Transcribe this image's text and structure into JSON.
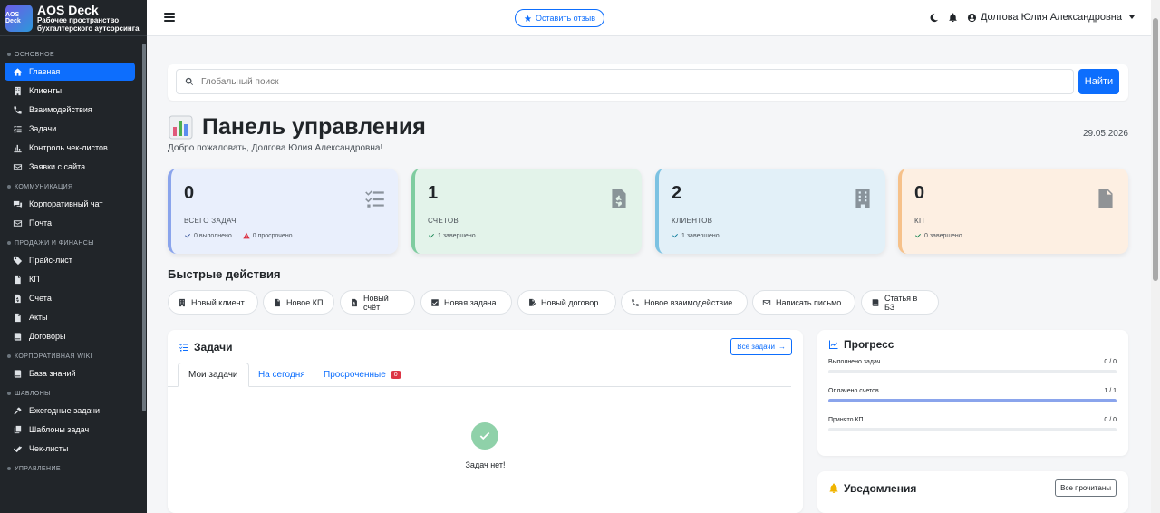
{
  "brand": {
    "title": "AOS Deck",
    "subtitle_line1": "Рабочее пространство",
    "subtitle_line2": "бухгалтерского аутсорсинга",
    "logo_text": "AOS Deck"
  },
  "sidebar": {
    "sections": [
      {
        "label": "ОСНОВНОЕ",
        "items": [
          {
            "label": "Главная",
            "icon": "home-icon",
            "active": true
          },
          {
            "label": "Клиенты",
            "icon": "building-icon"
          },
          {
            "label": "Взаимодействия",
            "icon": "phone-icon"
          },
          {
            "label": "Задачи",
            "icon": "tasks-icon"
          },
          {
            "label": "Контроль чек-листов",
            "icon": "bar-chart-icon"
          },
          {
            "label": "Заявки с сайта",
            "icon": "envelope-icon"
          }
        ]
      },
      {
        "label": "КОММУНИКАЦИЯ",
        "items": [
          {
            "label": "Корпоративный чат",
            "icon": "comments-icon"
          },
          {
            "label": "Почта",
            "icon": "envelope-icon"
          }
        ]
      },
      {
        "label": "ПРОДАЖИ И ФИНАНСЫ",
        "items": [
          {
            "label": "Прайс-лист",
            "icon": "tags-icon"
          },
          {
            "label": "КП",
            "icon": "file-icon"
          },
          {
            "label": "Счета",
            "icon": "file-invoice-icon"
          },
          {
            "label": "Акты",
            "icon": "file-icon"
          },
          {
            "label": "Договоры",
            "icon": "book-icon"
          }
        ]
      },
      {
        "label": "КОРПОРАТИВНАЯ WIKI",
        "items": [
          {
            "label": "База знаний",
            "icon": "book-icon"
          }
        ]
      },
      {
        "label": "ШАБЛОНЫ",
        "items": [
          {
            "label": "Ежегодные задачи",
            "icon": "hammer-icon"
          },
          {
            "label": "Шаблоны задач",
            "icon": "copy-icon"
          },
          {
            "label": "Чек-листы",
            "icon": "check-double-icon"
          }
        ]
      },
      {
        "label": "УПРАВЛЕНИЕ",
        "items": []
      }
    ]
  },
  "topbar": {
    "review_label": "Оставить отзыв",
    "user_name": "Долгова Юлия Александровна"
  },
  "search": {
    "placeholder": "Глобальный поиск",
    "button_label": "Найти"
  },
  "header": {
    "title": "Панель управления",
    "welcome": "Добро пожаловать, Долгова Юлия Александровна!",
    "date": "29.05.2026"
  },
  "stats": [
    {
      "value": "0",
      "label": "ВСЕГО ЗАДАЧ",
      "subs": [
        {
          "text": "0 выполнено",
          "color": "#3d5a9e",
          "icon": "check-icon"
        },
        {
          "text": "0 просрочено",
          "color": "#dc3545",
          "icon": "warning-icon"
        }
      ],
      "bg": "#e9effc",
      "border": "#8aa4ec",
      "icon": "tasks-icon"
    },
    {
      "value": "1",
      "label": "СЧЕТОВ",
      "subs": [
        {
          "text": "1 завершено",
          "color": "#198754",
          "icon": "check-icon"
        }
      ],
      "bg": "#e3f3ea",
      "border": "#7fcca0",
      "icon": "file-invoice-icon"
    },
    {
      "value": "2",
      "label": "КЛИЕНТОВ",
      "subs": [
        {
          "text": "1 завершено",
          "color": "#0c7c9c",
          "icon": "check-icon"
        }
      ],
      "bg": "#e2f0f8",
      "border": "#7cc2e2",
      "icon": "building-icon"
    },
    {
      "value": "0",
      "label": "КП",
      "subs": [
        {
          "text": "0 завершено",
          "color": "#198754",
          "icon": "check-icon"
        }
      ],
      "bg": "#fdefe2",
      "border": "#f6c18a",
      "icon": "file-icon"
    }
  ],
  "quick_actions": {
    "title": "Быстрые действия",
    "items": [
      {
        "label": "Новый клиент",
        "icon": "building-icon"
      },
      {
        "label": "Новое КП",
        "icon": "file-icon"
      },
      {
        "label": "Новый счёт",
        "icon": "file-invoice-icon"
      },
      {
        "label": "Новая задача",
        "icon": "check-square-icon"
      },
      {
        "label": "Новый договор",
        "icon": "file-signature-icon"
      },
      {
        "label": "Новое взаимодействие",
        "icon": "phone-icon"
      },
      {
        "label": "Написать письмо",
        "icon": "envelope-icon"
      },
      {
        "label": "Статья в БЗ",
        "icon": "book-icon"
      }
    ]
  },
  "tasks": {
    "title": "Задачи",
    "all_label": "Все задачи",
    "tabs": [
      {
        "label": "Мои задачи",
        "active": true
      },
      {
        "label": "На сегодня"
      },
      {
        "label": "Просроченные",
        "badge": "0"
      }
    ],
    "empty_text": "Задач нет!"
  },
  "progress": {
    "title": "Прогресс",
    "rows": [
      {
        "label": "Выполнено задач",
        "value": "0 / 0",
        "fraction": 0
      },
      {
        "label": "Оплачено счетов",
        "value": "1 / 1",
        "fraction": 1
      },
      {
        "label": "Принято КП",
        "value": "0 / 0",
        "fraction": 0
      }
    ]
  },
  "notifications": {
    "title": "Уведомления",
    "read_all_label": "Все прочитаны"
  },
  "colors": {
    "primary": "#0d6efd",
    "sidebar_bg": "#212529",
    "danger": "#dc3545"
  }
}
